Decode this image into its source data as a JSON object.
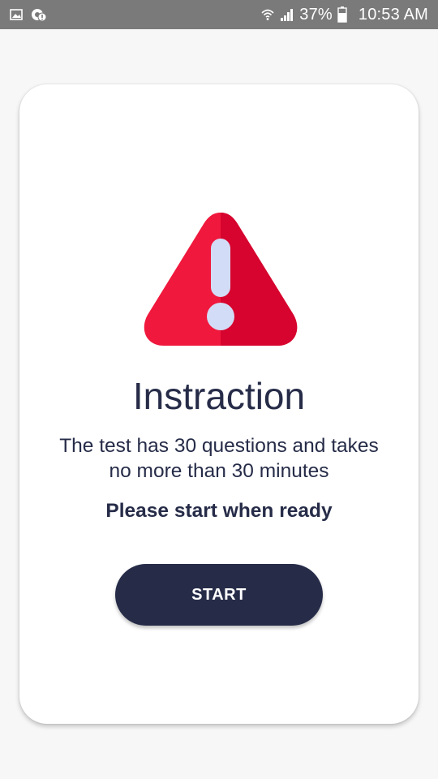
{
  "status_bar": {
    "battery": "37%",
    "time": "10:53 AM",
    "icons": [
      "image-icon",
      "notification-badge-icon",
      "wifi-icon",
      "signal-icon",
      "battery-icon"
    ]
  },
  "card": {
    "icon": "warning-triangle-icon",
    "title": "Instraction",
    "description_line1": "The test has 30 questions and takes",
    "description_line2": "no more than 30 minutes",
    "ready_text": "Please start when ready",
    "start_label": "START"
  },
  "colors": {
    "status_bar_bg": "#7a7a7a",
    "page_bg": "#f7f7f7",
    "card_bg": "#ffffff",
    "text_primary": "#262c48",
    "button_bg": "#262c48",
    "warning_red": "#f0183c",
    "warning_red_dark": "#d6042e",
    "exclamation": "#d3dcf6"
  }
}
